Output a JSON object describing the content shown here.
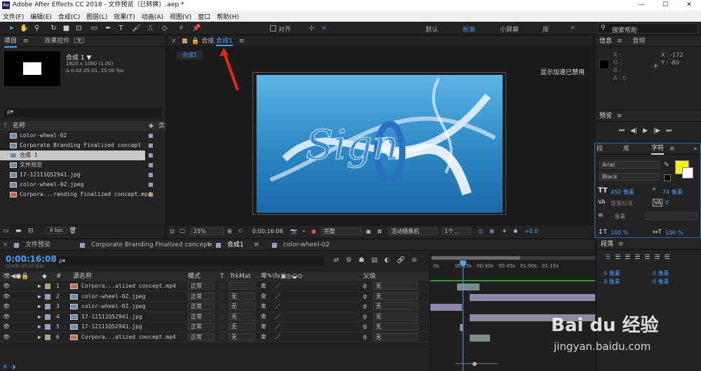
{
  "app": {
    "title": "Adobe After Effects CC 2018 - 文件预览（已转换）.aep *",
    "logo": "Ae",
    "win_buttons": [
      "—",
      "☐",
      "✕"
    ]
  },
  "menu": [
    "文件(F)",
    "编辑(E)",
    "合成(C)",
    "图层(L)",
    "效果(T)",
    "动画(A)",
    "视图(V)",
    "窗口",
    "帮助(H)"
  ],
  "toolbar": {
    "align_label": "对齐",
    "workspaces": [
      "默认",
      "标准",
      "小屏幕",
      "库"
    ],
    "active_workspace": "标准",
    "search_placeholder": "搜索帮助",
    "overflow": "»"
  },
  "project": {
    "tab": "项目",
    "effects_tab": "效果控件（无）",
    "comp_name": "合成 1 ▼",
    "comp_size": "1920 x 1080 (1.00)",
    "comp_duration": "Δ 0:02:25:01, 25.00 fps",
    "search_icon": "ρ▾",
    "name_header": "名称",
    "items": [
      {
        "name": "color-wheel-02",
        "color": "#9b9bc8",
        "type": "comp"
      },
      {
        "name": "Corporate Branding  Finalized concept",
        "color": "#9b9bc8",
        "type": "comp"
      },
      {
        "name": "合成 1",
        "color": "#9b9bc8",
        "type": "comp",
        "selected": true
      },
      {
        "name": "文件预览",
        "color": "#9b9bc8",
        "type": "comp"
      },
      {
        "name": "17-12111Q52941.jpg",
        "color": "#9b9bc8",
        "type": "img"
      },
      {
        "name": "color-wheel-02.jpeg",
        "color": "#9b9bc8",
        "type": "img"
      },
      {
        "name": "Corpora...randing  Finalized concept.mp4",
        "color": "#b8a07a",
        "type": "vid"
      }
    ],
    "bpc": "8 bpc"
  },
  "comp_viewer": {
    "tab_prefix": "合成",
    "tab_active": "合成1",
    "sub_tab": "合成1",
    "accel_msg": "显示加速已禁用",
    "zoom": "25%",
    "timecode": "0:00:16:08",
    "quality": "完整",
    "camera": "活动摄像机",
    "views": "1个...",
    "offset": "+0.0",
    "artwork_text": "Sign"
  },
  "info": {
    "tab": "信息",
    "audio_tab": "音频",
    "r": "R :",
    "g": "G :",
    "b": "B :",
    "a": "A : 0",
    "x": "X : -172",
    "y": "Y : -80"
  },
  "preview": {
    "tab": "预览",
    "controls": [
      "⏮",
      "◀|",
      "▶",
      "|▶",
      "⏭"
    ]
  },
  "character": {
    "tabs": [
      "段",
      "库",
      "字符"
    ],
    "active_tab": "字符",
    "font": "Arial",
    "style": "Black",
    "size": "450 像素",
    "leading": "74 像素",
    "kerning": "度量标准",
    "tracking": "0",
    "stroke": "- 像素",
    "vscale": "100 %",
    "hscale": "100 %",
    "fill_color": "#f4f020"
  },
  "paragraph": {
    "tab": "段落",
    "indent_values": [
      "0 像素",
      "0 像素",
      "0 像素",
      "0 像素"
    ]
  },
  "timeline": {
    "tabs": [
      "文件预览",
      "Corporate Branding  Finalized concept",
      "合成1",
      "color-wheel-02"
    ],
    "active_tab": "合成1",
    "timecode": "0:00:16:08",
    "frame_info": "00408 (25.00 fps)",
    "search_placeholder": "ρ▾",
    "col_source": "源名称",
    "col_mode": "模式",
    "col_t": "T",
    "col_trkmat": "TrkMat",
    "col_parent": "父级",
    "ruler": [
      "0s",
      "00:15s",
      "00:30s",
      "00:45s",
      "01:00s",
      "01:15s"
    ],
    "layers": [
      {
        "num": "1",
        "name": "Corpora...alized concept.mp4",
        "mode": "正常",
        "trkmat": "",
        "parent": "无",
        "color": "#b8a07a",
        "kind": "vid"
      },
      {
        "num": "2",
        "name": "color-wheel-02.jpeg",
        "mode": "正常",
        "trkmat": "无",
        "parent": "无",
        "color": "#9b9bc8",
        "kind": "img"
      },
      {
        "num": "3",
        "name": "color-wheel-02.jpeg",
        "mode": "正常",
        "trkmat": "无",
        "parent": "无",
        "color": "#9b9bc8",
        "kind": "img"
      },
      {
        "num": "4",
        "name": "17-12111Q52941.jpg",
        "mode": "正常",
        "trkmat": "无",
        "parent": "无",
        "color": "#9b9bc8",
        "kind": "img"
      },
      {
        "num": "5",
        "name": "17-12111Q52941.jpg",
        "mode": "正常",
        "trkmat": "无",
        "parent": "无",
        "color": "#9b9bc8",
        "kind": "img"
      },
      {
        "num": "6",
        "name": "Corpora...alized concept.mp4",
        "mode": "正常",
        "trkmat": "无",
        "parent": "无",
        "color": "#b8a07a",
        "kind": "vid"
      }
    ]
  },
  "watermark": {
    "brand": "Bai du 经验",
    "url": "jingyan.baidu.com"
  }
}
